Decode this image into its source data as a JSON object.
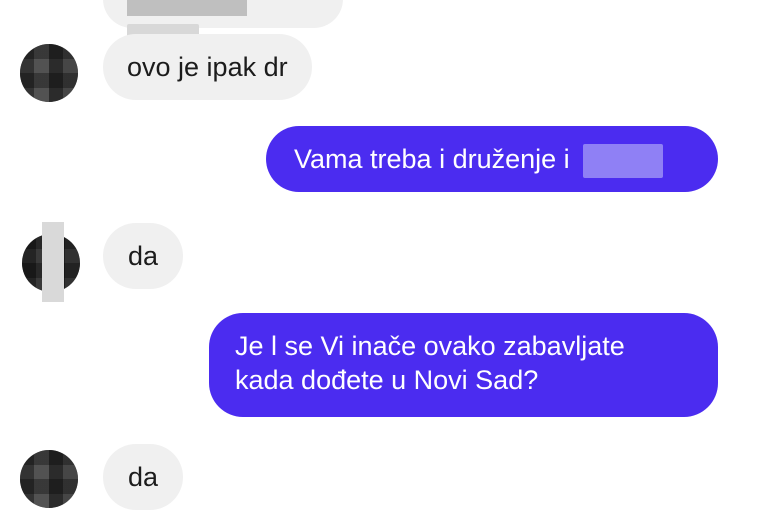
{
  "conversation": {
    "messages": [
      {
        "sender": "contact",
        "text": "(cut off at top)",
        "censored": true
      },
      {
        "sender": "contact",
        "text": "ovo je ipak dr"
      },
      {
        "sender": "me",
        "text": "Vama treba i druženje i",
        "censored": true
      },
      {
        "sender": "contact",
        "text": "da"
      },
      {
        "sender": "me",
        "line1": "Je l se Vi inače ovako zabavljate",
        "line2": "kada dođete u Novi Sad?"
      },
      {
        "sender": "contact",
        "text": "da"
      }
    ]
  },
  "colors": {
    "outgoing_bubble": "#4b2cf0",
    "incoming_bubble": "#f0f0f0",
    "incoming_text": "#1c1c1c",
    "outgoing_text": "#ffffff"
  },
  "icons": {
    "avatar": "pixelated-profile-photo"
  }
}
